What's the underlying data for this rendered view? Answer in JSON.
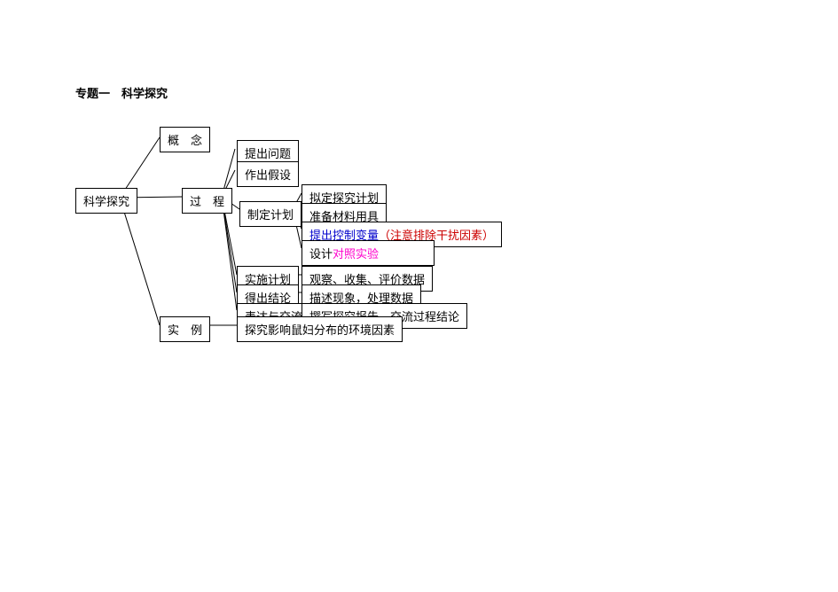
{
  "title": "专题一　科学探究",
  "root": "科学探究",
  "level1": {
    "concept": "概　念",
    "process": "过　程",
    "example": "实　例"
  },
  "process_steps": {
    "propose_question": "提出问题",
    "make_hypothesis": "作出假设",
    "make_plan": "制定计划",
    "implement_plan": "实施计划",
    "draw_conclusion": "得出结论",
    "express_exchange": "表达与交流"
  },
  "plan_details": {
    "draft_plan": "拟定探究计划",
    "prepare_materials": "准备材料用具",
    "control_variable": {
      "main": "提出控制变量",
      "note": "（注意排除干扰因素）"
    },
    "design_control": {
      "prefix": "设计",
      "highlight": "对照实验"
    }
  },
  "process_details": {
    "implement_detail": "观察、收集、评价数据",
    "conclusion_detail": "描述现象，处理数据",
    "exchange_detail": "撰写探究报告，交流过程结论"
  },
  "example_detail": "探究影响鼠妇分布的环境因素"
}
